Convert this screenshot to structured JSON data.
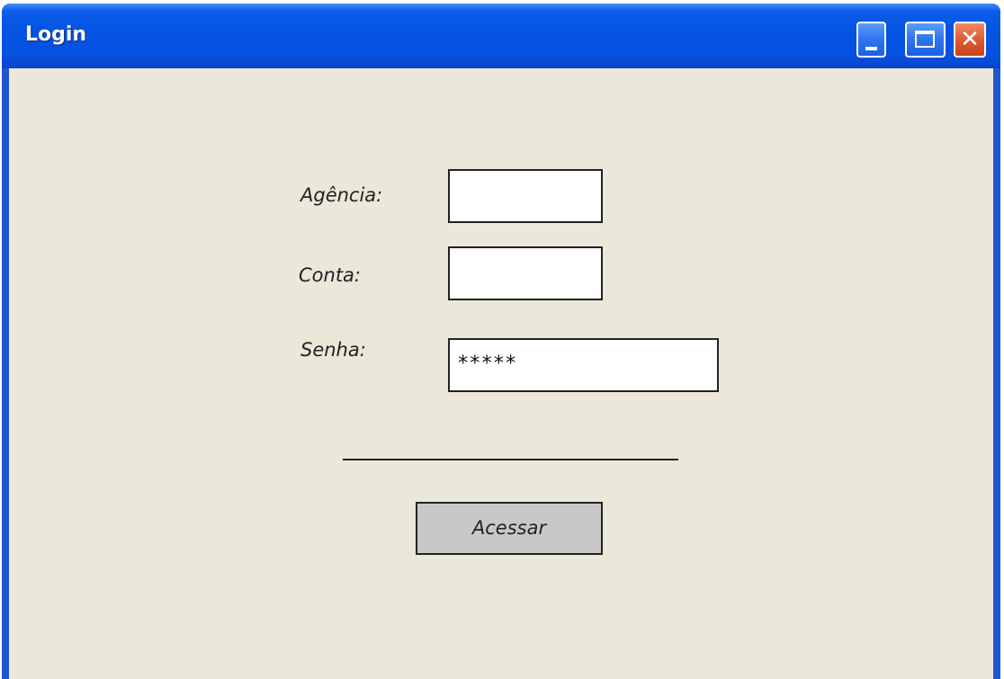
{
  "window": {
    "title": "Login",
    "controls": {
      "minimize_icon": "minimize-icon",
      "maximize_icon": "maximize-icon",
      "close_icon": "close-icon",
      "close_glyph": "✕"
    }
  },
  "form": {
    "agencia": {
      "label": "Agência:",
      "value": ""
    },
    "conta": {
      "label": "Conta:",
      "value": ""
    },
    "senha": {
      "label": "Senha:",
      "value": "*****"
    },
    "submit_label": "Acessar"
  },
  "colors": {
    "titlebar": "#0453e1",
    "client_background": "#ebe7d9",
    "button_background": "#c8c8c8",
    "close_button": "#e05c30"
  }
}
